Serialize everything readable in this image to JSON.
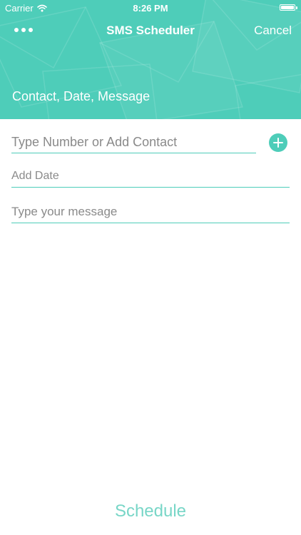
{
  "status_bar": {
    "carrier": "Carrier",
    "time": "8:26 PM",
    "icons": [
      "wifi-icon",
      "battery-icon"
    ]
  },
  "nav": {
    "more_icon": "more-horizontal-icon",
    "title": "SMS Scheduler",
    "cancel_label": "Cancel"
  },
  "header": {
    "section_title": "Contact, Date, Message"
  },
  "form": {
    "number": {
      "value": "",
      "placeholder": "Type Number or Add Contact"
    },
    "add_contact_icon": "plus-circle-icon",
    "date": {
      "value": "",
      "placeholder": "Add Date"
    },
    "message": {
      "value": "",
      "placeholder": "Type your message"
    }
  },
  "footer": {
    "schedule_label": "Schedule"
  },
  "colors": {
    "accent": "#4ecdb9",
    "schedule_text": "#78d6c7",
    "placeholder": "#8a8a8a"
  }
}
